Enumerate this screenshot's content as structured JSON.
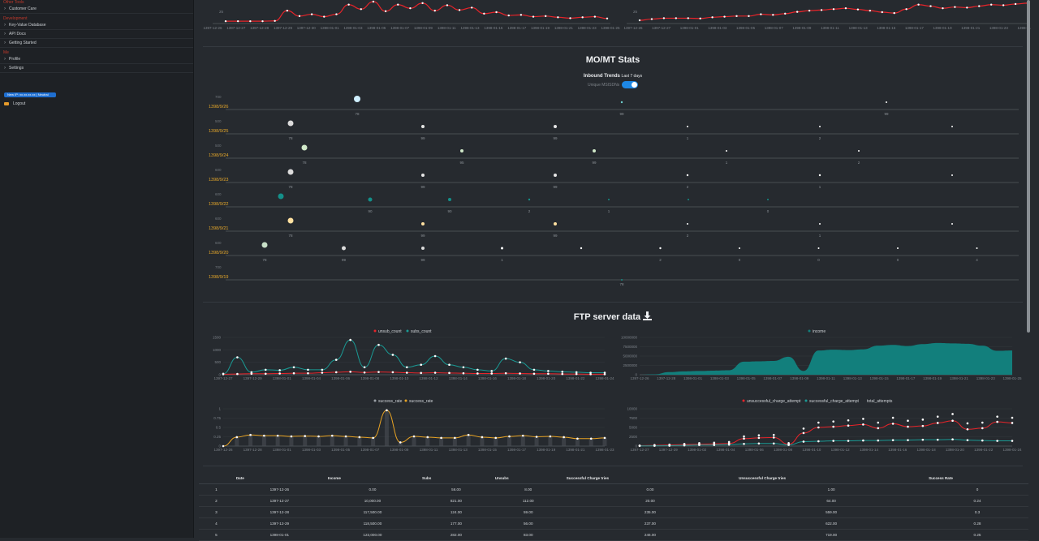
{
  "sidebar": {
    "section_heads": [
      "Other Tools",
      "Development",
      "Me"
    ],
    "items": [
      {
        "label": "Customer Care"
      },
      {
        "label": "Key-Value Database"
      },
      {
        "label": "API Docs"
      },
      {
        "label": "Getting Started"
      },
      {
        "label": "Profile"
      },
      {
        "label": "Settings"
      }
    ],
    "new_button_label": "New IP: xx.xx.xx.xx | Neutral",
    "logout_label": "Logout"
  },
  "top_charts": {
    "left": {
      "y_ticks": [
        "25"
      ],
      "x_labels": [
        "1397-12-26",
        "1397-12-27",
        "1397-12-28",
        "1397-12-29",
        "1397-12-30",
        "1398-01-01",
        "1398-01-03",
        "1398-01-05",
        "1398-01-07",
        "1398-01-09",
        "1398-01-11",
        "1398-01-13",
        "1398-01-15",
        "1398-01-17",
        "1398-01-19",
        "1398-01-21",
        "1398-01-23",
        "1398-01-25"
      ],
      "series_color": "#e8242a",
      "values": [
        5,
        5,
        5,
        5,
        6,
        40,
        22,
        28,
        20,
        28,
        60,
        45,
        70,
        38,
        60,
        48,
        65,
        40,
        58,
        42,
        50,
        30,
        35,
        24,
        26,
        20,
        22,
        18,
        15,
        18,
        20,
        14
      ]
    },
    "right": {
      "y_ticks": [
        "25"
      ],
      "x_labels": [
        "1397-12-26",
        "1397-12-27",
        "1398-01-01",
        "1398-01-03",
        "1398-01-05",
        "1398-01-07",
        "1398-01-09",
        "1398-01-11",
        "1398-01-13",
        "1398-01-15",
        "1398-01-17",
        "1398-01-19",
        "1398-01-21",
        "1398-01-23",
        "1398-01-25"
      ],
      "series_color": "#e8242a",
      "values": [
        8,
        12,
        15,
        15,
        15,
        14,
        18,
        20,
        22,
        22,
        28,
        26,
        30,
        36,
        40,
        42,
        45,
        48,
        44,
        40,
        35,
        32,
        45,
        60,
        55,
        48,
        52,
        50,
        55,
        60,
        58,
        62,
        65
      ]
    }
  },
  "mo_mt": {
    "title": "MO/MT Stats",
    "subtitle": "Inbound Trends",
    "subtitle_small": "Last 7 days",
    "toggle_label": "Unique MSISDNs",
    "rows": [
      {
        "date": "1398/9/26",
        "tick": "700",
        "points": [
          {
            "c": "#cfefff",
            "s": 4,
            "l": "78"
          },
          {
            "c": "#6fd0d0",
            "s": 1.2,
            "l": "99"
          },
          {
            "c": "#ffffff",
            "s": 1,
            "l": "99"
          }
        ]
      },
      {
        "date": "1398/9/25",
        "tick": "500",
        "points": [
          {
            "c": "#dcdcdc",
            "s": 3.5,
            "l": "78"
          },
          {
            "c": "#e6e6e6",
            "s": 2,
            "l": "99"
          },
          {
            "c": "#e6e6e6",
            "s": 2,
            "l": "99"
          },
          {
            "c": "#ffffff",
            "s": 1,
            "l": "1"
          },
          {
            "c": "#ffffff",
            "s": 1,
            "l": "2"
          },
          {
            "c": "#ffffff",
            "s": 1,
            "l": ""
          }
        ]
      },
      {
        "date": "1398/9/24",
        "tick": "500",
        "points": [
          {
            "c": "#d0e8c8",
            "s": 3.5,
            "l": "78"
          },
          {
            "c": "#d0e8c8",
            "s": 2,
            "l": "95"
          },
          {
            "c": "#d0e8c8",
            "s": 2,
            "l": "99"
          },
          {
            "c": "#ffffff",
            "s": 1,
            "l": "1"
          },
          {
            "c": "#ffffff",
            "s": 1,
            "l": "2"
          }
        ]
      },
      {
        "date": "1398/9/23",
        "tick": "600",
        "points": [
          {
            "c": "#dcdcdc",
            "s": 3.5,
            "l": "78"
          },
          {
            "c": "#e6e6e6",
            "s": 2,
            "l": "99"
          },
          {
            "c": "#e6e6e6",
            "s": 2,
            "l": "99"
          },
          {
            "c": "#ffffff",
            "s": 1.2,
            "l": "2"
          },
          {
            "c": "#ffffff",
            "s": 1.2,
            "l": "1"
          },
          {
            "c": "#ffffff",
            "s": 1,
            "l": ""
          }
        ]
      },
      {
        "date": "1398/9/22",
        "tick": "600",
        "points": [
          {
            "c": "#14908a",
            "s": 3.5,
            "l": ""
          },
          {
            "c": "#14908a",
            "s": 2.5,
            "l": "90"
          },
          {
            "c": "#14908a",
            "s": 2,
            "l": "90"
          },
          {
            "c": "#14908a",
            "s": 1.2,
            "l": "2"
          },
          {
            "c": "#14908a",
            "s": 1,
            "l": "1"
          },
          {
            "c": "#14908a",
            "s": 1,
            "l": ""
          },
          {
            "c": "#14908a",
            "s": 1,
            "l": "0"
          }
        ]
      },
      {
        "date": "1398/9/21",
        "tick": "600",
        "points": [
          {
            "c": "#ffe0a0",
            "s": 3.5,
            "l": "78"
          },
          {
            "c": "#ffe0a0",
            "s": 2,
            "l": "99"
          },
          {
            "c": "#ffe0a0",
            "s": 2,
            "l": "99"
          },
          {
            "c": "#ffffff",
            "s": 1,
            "l": "2"
          },
          {
            "c": "#ffffff",
            "s": 1,
            "l": "1"
          },
          {
            "c": "#ffffff",
            "s": 1,
            "l": ""
          }
        ]
      },
      {
        "date": "1398/9/20",
        "tick": "600",
        "points": [
          {
            "c": "#c8e0c8",
            "s": 3.5,
            "l": "78"
          },
          {
            "c": "#dcdcdc",
            "s": 2.5,
            "l": "99"
          },
          {
            "c": "#dcdcdc",
            "s": 2,
            "l": "99"
          },
          {
            "c": "#ffffff",
            "s": 1.5,
            "l": "1"
          },
          {
            "c": "#ffffff",
            "s": 1.2,
            "l": ""
          },
          {
            "c": "#ffffff",
            "s": 1.2,
            "l": "2"
          },
          {
            "c": "#ffffff",
            "s": 1,
            "l": "0"
          },
          {
            "c": "#ffffff",
            "s": 1,
            "l": "0"
          },
          {
            "c": "#ffffff",
            "s": 1,
            "l": "0"
          },
          {
            "c": "#ffffff",
            "s": 1,
            "l": "4"
          }
        ]
      },
      {
        "date": "1398/9/19",
        "tick": "700",
        "points": [
          {
            "c": "#14908a",
            "s": 1,
            "l": "78"
          }
        ]
      }
    ]
  },
  "ftp": {
    "title": "FTP server data",
    "subs_chart": {
      "legend": [
        "unsub_count",
        "subs_count"
      ],
      "colors": [
        "#e8242a",
        "#1a9a94"
      ],
      "y_ticks": [
        "1500",
        "1000",
        "500",
        "0"
      ],
      "x_labels": [
        "1397-12-27",
        "1397-12-29",
        "1398-01-01",
        "1398-01-04",
        "1398-01-06",
        "1398-01-08",
        "1398-01-10",
        "1398-01-12",
        "1398-01-14",
        "1398-01-16",
        "1398-01-18",
        "1398-01-20",
        "1398-01-22",
        "1398-01-24"
      ],
      "subs": [
        40,
        700,
        100,
        200,
        180,
        300,
        200,
        200,
        600,
        1400,
        300,
        1200,
        800,
        300,
        400,
        750,
        400,
        300,
        200,
        150,
        650,
        500,
        200,
        150,
        120,
        100,
        80,
        80
      ],
      "unsubs": [
        20,
        30,
        40,
        40,
        50,
        60,
        60,
        80,
        100,
        120,
        90,
        110,
        100,
        80,
        70,
        80,
        70,
        60,
        50,
        50,
        60,
        50,
        40,
        40,
        30,
        30,
        20,
        20
      ]
    },
    "income_chart": {
      "legend": [
        "income"
      ],
      "color": "#127f7c",
      "y_ticks": [
        "10000000",
        "7500000",
        "5000000",
        "2500000",
        "0"
      ],
      "x_labels": [
        "1397-12-26",
        "1397-12-28",
        "1398-01-01",
        "1398-01-03",
        "1398-01-05",
        "1398-01-07",
        "1398-01-09",
        "1398-01-11",
        "1398-01-13",
        "1398-01-15",
        "1398-01-17",
        "1398-01-19",
        "1398-01-21",
        "1398-01-23",
        "1398-01-25"
      ],
      "values": [
        0,
        100000,
        700000,
        900000,
        1000000,
        1100000,
        1200000,
        3500000,
        3600000,
        3700000,
        4800000,
        1000000,
        6500000,
        6700000,
        6600000,
        6800000,
        7800000,
        8000000,
        7700000,
        8200000,
        8500000,
        8400000,
        8300000,
        7800000,
        6400000,
        6500000
      ]
    },
    "rate_chart": {
      "legend": [
        "success_rate",
        "success_rate"
      ],
      "colors": [
        "#9aa0a6",
        "#e8a324"
      ],
      "y_ticks": [
        "1",
        "0.75",
        "0.5",
        "0.25",
        "0"
      ],
      "x_labels": [
        "1397-12-26",
        "1397-12-28",
        "1398-01-01",
        "1398-01-03",
        "1398-01-05",
        "1398-01-07",
        "1398-01-09",
        "1398-01-11",
        "1398-01-13",
        "1398-01-15",
        "1398-01-17",
        "1398-01-19",
        "1398-01-21",
        "1398-01-23"
      ],
      "values": [
        0,
        0.24,
        0.3,
        0.28,
        0.28,
        0.26,
        0.27,
        0.26,
        0.28,
        0.26,
        0.24,
        0.22,
        0.96,
        0.1,
        0.26,
        0.24,
        0.22,
        0.22,
        0.3,
        0.24,
        0.22,
        0.26,
        0.28,
        0.25,
        0.26,
        0.24,
        0.2,
        0.2,
        0.22
      ]
    },
    "charge_chart": {
      "legend": [
        "unsuccessful_charge_attempt",
        "successful_charge_attempt",
        "total_attempts"
      ],
      "colors": [
        "#e8242a",
        "#1a9a94",
        "#ffffff"
      ],
      "y_ticks": [
        "10000",
        "7500",
        "5000",
        "2500",
        "0"
      ],
      "x_labels": [
        "1397-12-27",
        "1397-12-29",
        "1398-01-02",
        "1398-01-04",
        "1398-01-06",
        "1398-01-08",
        "1398-01-10",
        "1398-01-12",
        "1398-01-14",
        "1398-01-16",
        "1398-01-18",
        "1398-01-20",
        "1398-01-22",
        "1398-01-24"
      ],
      "unsucc": [
        100,
        200,
        300,
        400,
        500,
        600,
        700,
        2000,
        2200,
        2300,
        500,
        3500,
        5000,
        5200,
        5500,
        5800,
        4800,
        6000,
        5200,
        5400,
        6200,
        6800,
        4500,
        4800,
        6500,
        6200
      ],
      "succ": [
        50,
        80,
        100,
        200,
        300,
        300,
        400,
        600,
        700,
        700,
        300,
        1200,
        1300,
        1400,
        1400,
        1500,
        1500,
        1600,
        1600,
        1700,
        1700,
        1800,
        1600,
        1500,
        1400,
        1400
      ],
      "total": [
        150,
        280,
        400,
        600,
        800,
        900,
        1100,
        2600,
        2900,
        3000,
        800,
        4700,
        6300,
        6600,
        6900,
        7300,
        6300,
        7600,
        6800,
        7100,
        7900,
        8600,
        6100,
        6300,
        7900,
        7600
      ]
    },
    "table": {
      "headers": [
        "",
        "Date",
        "Income",
        "Subs",
        "Unsubs",
        "Successful Charge tries",
        "Unsuccessful Charge tries",
        "Success Rate"
      ],
      "rows": [
        [
          "1",
          "1397-12-26",
          "0.00",
          "56.00",
          "8.00",
          "0.00",
          "1.00",
          "0"
        ],
        [
          "2",
          "1397-12-27",
          "10,000.00",
          "821.00",
          "112.00",
          "20.00",
          "64.00",
          "0.24"
        ],
        [
          "3",
          "1397-12-28",
          "117,500.00",
          "124.00",
          "59.00",
          "235.00",
          "559.00",
          "0.3"
        ],
        [
          "4",
          "1397-12-29",
          "118,500.00",
          "177.00",
          "56.00",
          "237.00",
          "622.00",
          "0.28"
        ],
        [
          "5",
          "1398-01-01",
          "123,000.00",
          "282.00",
          "83.00",
          "246.00",
          "719.00",
          "0.25"
        ]
      ]
    }
  }
}
